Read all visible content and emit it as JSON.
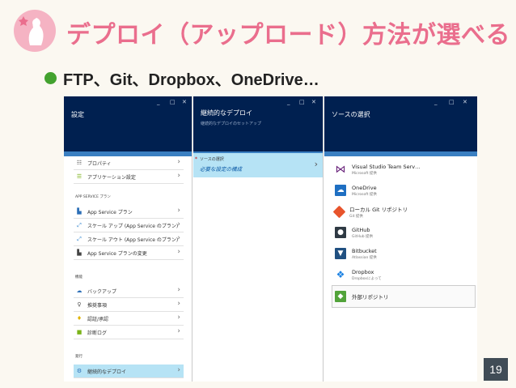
{
  "slide": {
    "title": "デプロイ（アップロード）方法が選べる",
    "bullet": "FTP、Git、Dropbox、OneDrive…",
    "page_number": "19",
    "colors": {
      "title": "#ea6e8d",
      "bullet": "#43a22f",
      "header": "#002050",
      "selection": "#b6e3f5"
    }
  },
  "blade1": {
    "title": "設定",
    "window_controls": [
      "_",
      "□",
      "✕"
    ],
    "items_top": [
      {
        "label": "プロパティ",
        "icon": "properties-icon"
      },
      {
        "label": "アプリケーション設定",
        "icon": "app-settings-icon"
      }
    ],
    "section_app_service": "APP SERVICE プラン",
    "items_app_service": [
      {
        "label": "App Service プラン",
        "icon": "app-service-plan-icon"
      },
      {
        "label": "スケール アップ (App Service のプラン)",
        "icon": "scale-up-icon"
      },
      {
        "label": "スケール アウト (App Service のプラン)",
        "icon": "scale-out-icon"
      },
      {
        "label": "App Service プランの変更",
        "icon": "change-plan-icon"
      }
    ],
    "section_features": "機能",
    "items_features": [
      {
        "label": "バックアップ",
        "icon": "backup-icon"
      },
      {
        "label": "推奨事項",
        "icon": "recommendations-icon"
      },
      {
        "label": "認証/承認",
        "icon": "auth-icon"
      },
      {
        "label": "診断ログ",
        "icon": "diagnostics-log-icon"
      }
    ],
    "section_publish": "発行",
    "items_publish": [
      {
        "label": "継続的なデプロイ",
        "icon": "continuous-deploy-icon"
      }
    ]
  },
  "blade2": {
    "title": "継続的なデプロイ",
    "subtitle": "継続的なデプロイのセットアップ",
    "window_controls": [
      "_",
      "□",
      "✕"
    ],
    "selected_line1": "ソースの選択",
    "selected_line2": "必要な設定の構成"
  },
  "blade3": {
    "title": "ソースの選択",
    "window_controls": [
      "_",
      "□",
      "✕"
    ],
    "sources": [
      {
        "name": "Visual Studio Team Serv…",
        "desc": "Microsoft 提供",
        "icon": "visual-studio-icon",
        "color": "#68217a"
      },
      {
        "name": "OneDrive",
        "desc": "Microsoft 提供",
        "icon": "onedrive-icon",
        "color": "#1e6fc2"
      },
      {
        "name": "ローカル Git リポジトリ",
        "desc": "Git 提供",
        "icon": "git-icon",
        "color": "#e8542c"
      },
      {
        "name": "GitHub",
        "desc": "GitHub 提供",
        "icon": "github-icon",
        "color": "#2f3a44"
      },
      {
        "name": "Bitbucket",
        "desc": "Atlassian 提供",
        "icon": "bitbucket-icon",
        "color": "#205081"
      },
      {
        "name": "Dropbox",
        "desc": "Dropboxによって",
        "icon": "dropbox-icon",
        "color": "#1b81e2"
      },
      {
        "name": "外部リポジトリ",
        "desc": "",
        "icon": "external-repo-icon",
        "color": "#52a33a"
      }
    ]
  }
}
